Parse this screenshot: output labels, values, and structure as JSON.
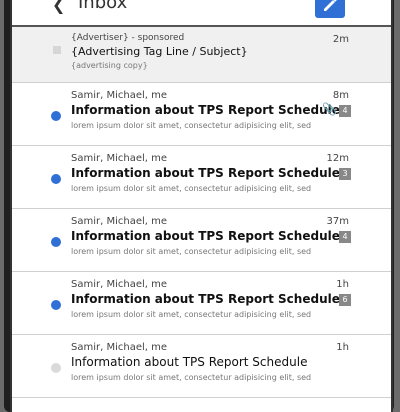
{
  "header": {
    "title": "Inbox",
    "back_icon": "chevron-left-icon",
    "compose_icon": "pencil-icon"
  },
  "ad": {
    "sender": "{Advertiser} - sponsored",
    "time": "2m",
    "subject": "{Advertising Tag Line / Subject}",
    "preview": "{advertising copy}"
  },
  "messages": [
    {
      "sender": "Samir, Michael, me",
      "time": "8m",
      "subject": "Information about TPS Report Schedule",
      "preview": "lorem ipsum dolor sit amet, consectetur adipisicing elit, sed",
      "count": "4",
      "unread": true,
      "attachment": true
    },
    {
      "sender": "Samir, Michael, me",
      "time": "12m",
      "subject": "Information about TPS Report Schedule",
      "preview": "lorem ipsum dolor sit amet, consectetur adipisicing elit, sed",
      "count": "3",
      "unread": true,
      "attachment": false
    },
    {
      "sender": "Samir, Michael, me",
      "time": "37m",
      "subject": "Information about TPS Report Schedule",
      "preview": "lorem ipsum dolor sit amet, consectetur adipisicing elit, sed",
      "count": "4",
      "unread": true,
      "attachment": false
    },
    {
      "sender": "Samir, Michael, me",
      "time": "1h",
      "subject": "Information about TPS Report Schedule",
      "preview": "lorem ipsum dolor sit amet, consectetur adipisicing elit, sed",
      "count": "6",
      "unread": true,
      "attachment": false
    },
    {
      "sender": "Samir, Michael, me",
      "time": "1h",
      "subject": "Information about TPS Report Schedule",
      "preview": "lorem ipsum dolor sit amet, consectetur adipisicing elit, sed",
      "count": "",
      "unread": false,
      "attachment": false
    }
  ],
  "colors": {
    "accent": "#2f6fd6",
    "unread_dot": "#2f6fd6",
    "read_dot": "#dadada"
  }
}
